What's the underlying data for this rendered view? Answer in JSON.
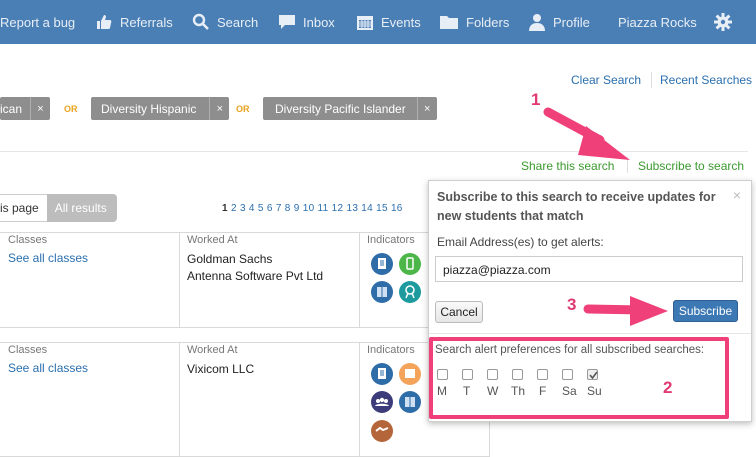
{
  "topnav": {
    "report_bug": "Report a bug",
    "referrals": "Referrals",
    "search": "Search",
    "inbox": "Inbox",
    "events": "Events",
    "folders": "Folders",
    "profile": "Profile",
    "network": "Piazza Rocks"
  },
  "links": {
    "clear_search": "Clear Search",
    "recent_searches": "Recent Searches"
  },
  "filters": {
    "chip1": "ican",
    "chip2": "Diversity Hispanic",
    "chip3": "Diversity Pacific Islander",
    "remove": "×",
    "or": "OR"
  },
  "actions": {
    "share": "Share this search",
    "subscribe": "Subscribe to search"
  },
  "view_toggle": {
    "this_page": "is page",
    "all_results": "All results"
  },
  "pagination": {
    "pages": [
      "1",
      "2",
      "3",
      "4",
      "5",
      "6",
      "7",
      "8",
      "9",
      "10",
      "11",
      "12",
      "13",
      "14",
      "15",
      "16"
    ]
  },
  "results": [
    {
      "classes_label": "Classes",
      "classes_link": "See all classes",
      "worked_label": "Worked At",
      "companies": [
        "Goldman Sachs",
        "Antenna Software Pvt Ltd"
      ],
      "indicators_label": "Indicators"
    },
    {
      "classes_label": "Classes",
      "classes_link": "See all classes",
      "worked_label": "Worked At",
      "companies": [
        "Vixicom LLC"
      ],
      "indicators_label": "Indicators"
    }
  ],
  "popup": {
    "title": "Subscribe to this search to receive updates for new students that match",
    "close": "×",
    "email_label": "Email Address(es) to get alerts:",
    "email_value": "piazza@piazza.com",
    "cancel": "Cancel",
    "subscribe": "Subscribe",
    "pref_label": "Search alert preferences for all subscribed searches:",
    "days": [
      "M",
      "T",
      "W",
      "Th",
      "F",
      "Sa",
      "Su"
    ],
    "checked": [
      false,
      false,
      false,
      false,
      false,
      false,
      true
    ]
  },
  "annotations": {
    "n1": "1",
    "n2": "2",
    "n3": "3"
  },
  "colors": {
    "navbar": "#4a7fb5",
    "accent_pink": "#f0407a",
    "link_blue": "#2a6fae",
    "share_green": "#3a9a2e",
    "or_orange": "#e8a21d",
    "subscribe_blue": "#3c78b4"
  }
}
